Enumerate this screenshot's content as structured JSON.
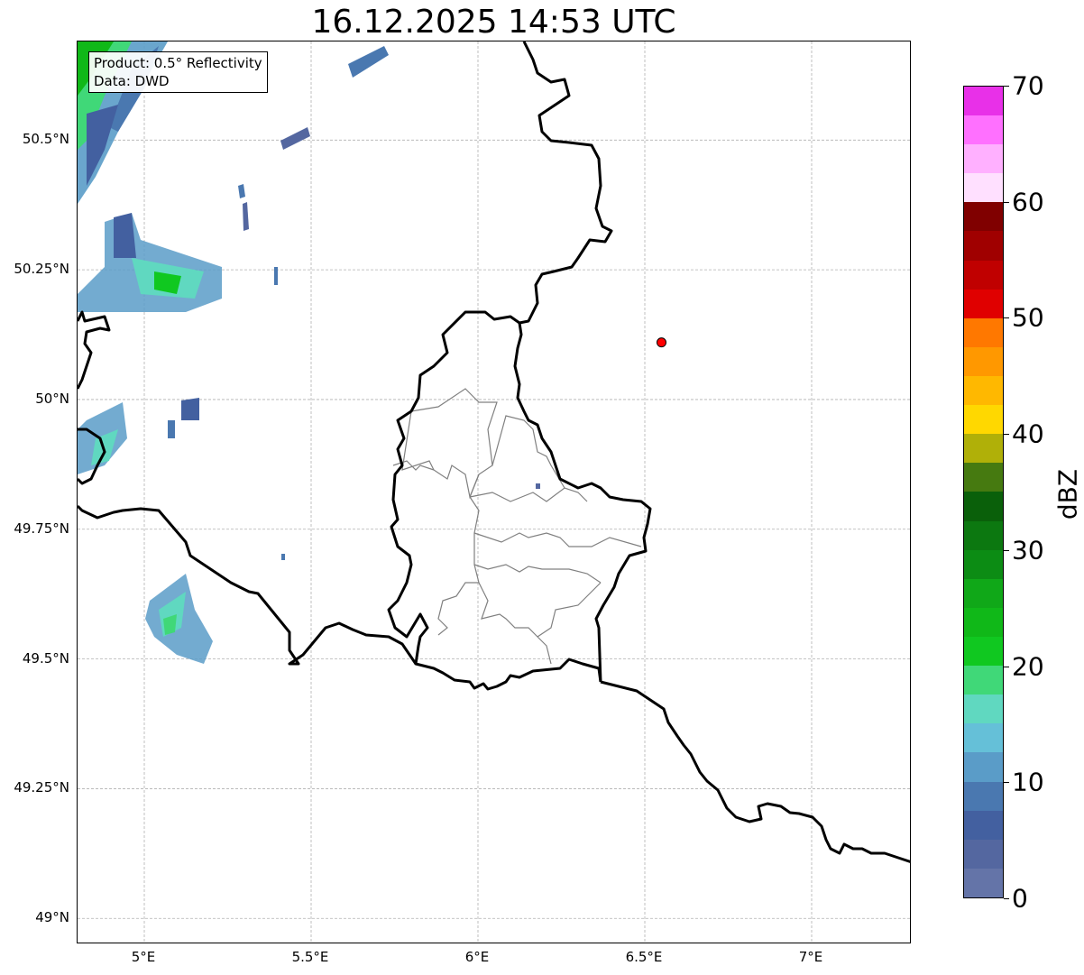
{
  "title": "16.12.2025 14:53 UTC",
  "info": {
    "product": "Product: 0.5° Reflectivity",
    "data_source": "Data: DWD"
  },
  "map": {
    "lon_range": [
      4.8,
      7.3
    ],
    "lat_range": [
      48.95,
      50.69
    ],
    "gridlines": true,
    "lat_ticks": [
      {
        "value": 50.5,
        "label": "50.5°N"
      },
      {
        "value": 50.25,
        "label": "50.25°N"
      },
      {
        "value": 50.0,
        "label": "50°N"
      },
      {
        "value": 49.75,
        "label": "49.75°N"
      },
      {
        "value": 49.5,
        "label": "49.5°N"
      },
      {
        "value": 49.25,
        "label": "49.25°N"
      },
      {
        "value": 49.0,
        "label": "49°N"
      }
    ],
    "lon_ticks": [
      {
        "value": 5.0,
        "label": "5°E"
      },
      {
        "value": 5.5,
        "label": "5.5°E"
      },
      {
        "value": 6.0,
        "label": "6°E"
      },
      {
        "value": 6.5,
        "label": "6.5°E"
      },
      {
        "value": 7.0,
        "label": "7°E"
      }
    ],
    "marker": {
      "lon": 6.55,
      "lat": 50.11,
      "color": "#ff0000"
    },
    "border_color": "#000000",
    "district_color": "#808080"
  },
  "colorbar": {
    "label": "dBZ",
    "min": 0,
    "max": 70,
    "ticks": [
      "0",
      "10",
      "20",
      "30",
      "40",
      "50",
      "60",
      "70"
    ],
    "colors": [
      "#6474a8",
      "#5467a0",
      "#4360a0",
      "#4a78b0",
      "#5a9cc8",
      "#65c0d8",
      "#60d8c0",
      "#40d878",
      "#10c820",
      "#10b818",
      "#10a818",
      "#0c8c14",
      "#0c7810",
      "#0a600a",
      "#467a10",
      "#b0b008",
      "#ffd800",
      "#ffb800",
      "#ff9800",
      "#ff7800",
      "#e00000",
      "#c00000",
      "#a00000",
      "#800000",
      "#ffe0ff",
      "#ffb0ff",
      "#ff70ff",
      "#e830e8"
    ]
  }
}
